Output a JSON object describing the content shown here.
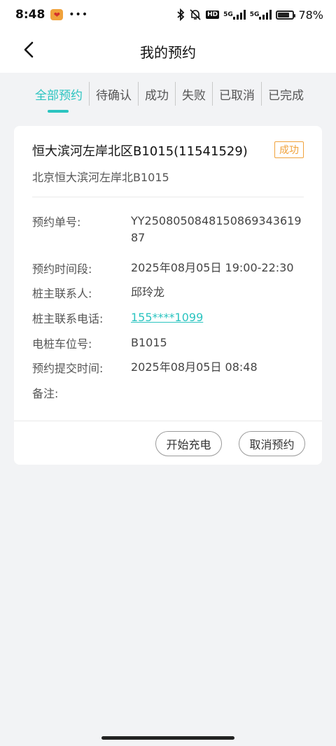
{
  "status_bar": {
    "time": "8:48",
    "app_badge": "❤",
    "dots": "•••",
    "hd": "HD",
    "net1": "5G",
    "net2": "5G",
    "battery_pct": "78",
    "battery_level": 0.78,
    "icons": [
      "bluetooth-icon",
      "mute-bell-icon",
      "signal-icon",
      "battery-icon"
    ]
  },
  "nav": {
    "back_icon": "chevron-left-icon",
    "title": "我的预约"
  },
  "tabs": [
    {
      "label": "全部预约",
      "active": true
    },
    {
      "label": "待确认",
      "active": false
    },
    {
      "label": "成功",
      "active": false
    },
    {
      "label": "失败",
      "active": false
    },
    {
      "label": "已取消",
      "active": false
    },
    {
      "label": "已完成",
      "active": false
    }
  ],
  "booking": {
    "title": "恒大滨河左岸北区B1015(11541529)",
    "status": "成功",
    "subtitle": "北京恒大滨河左岸北B1015",
    "rows": [
      {
        "label": "预约单号:",
        "value": "YY2508050848150869343619 87"
      },
      {
        "label": "预约时间段:",
        "value": "2025年08月05日 19:00-22:30"
      },
      {
        "label": "桩主联系人:",
        "value": "邱玲龙"
      },
      {
        "label": "桩主联系电话:",
        "value": "155****1099"
      },
      {
        "label": "电桩车位号:",
        "value": "B1015"
      },
      {
        "label": "预约提交时间:",
        "value": "2025年08月05日 08:48"
      },
      {
        "label": "备注:",
        "value": ""
      }
    ],
    "start_label": "开始充电",
    "cancel_label": "取消预约"
  },
  "colors": {
    "accent": "#2bc4c0",
    "status_badge": "#f0a23b",
    "background": "#f2f3f5"
  }
}
